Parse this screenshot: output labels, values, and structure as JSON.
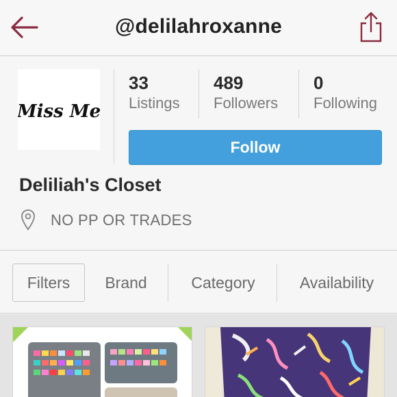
{
  "header": {
    "title": "@delilahroxanne",
    "back_icon": "back-arrow-icon",
    "share_icon": "share-icon",
    "accent_color": "#8a2a3f"
  },
  "profile": {
    "avatar_text": "Miss Me",
    "stats": [
      {
        "value": "33",
        "label": "Listings"
      },
      {
        "value": "489",
        "label": "Followers"
      },
      {
        "value": "0",
        "label": "Following"
      }
    ],
    "follow_label": "Follow",
    "follow_color": "#43a0dc",
    "closet_name": "Deliliah's Closet",
    "location_icon": "location-pin-icon",
    "location_text": "NO PP OR TRADES"
  },
  "filters": {
    "items": [
      "Filters",
      "Brand",
      "Category",
      "Availability"
    ]
  }
}
